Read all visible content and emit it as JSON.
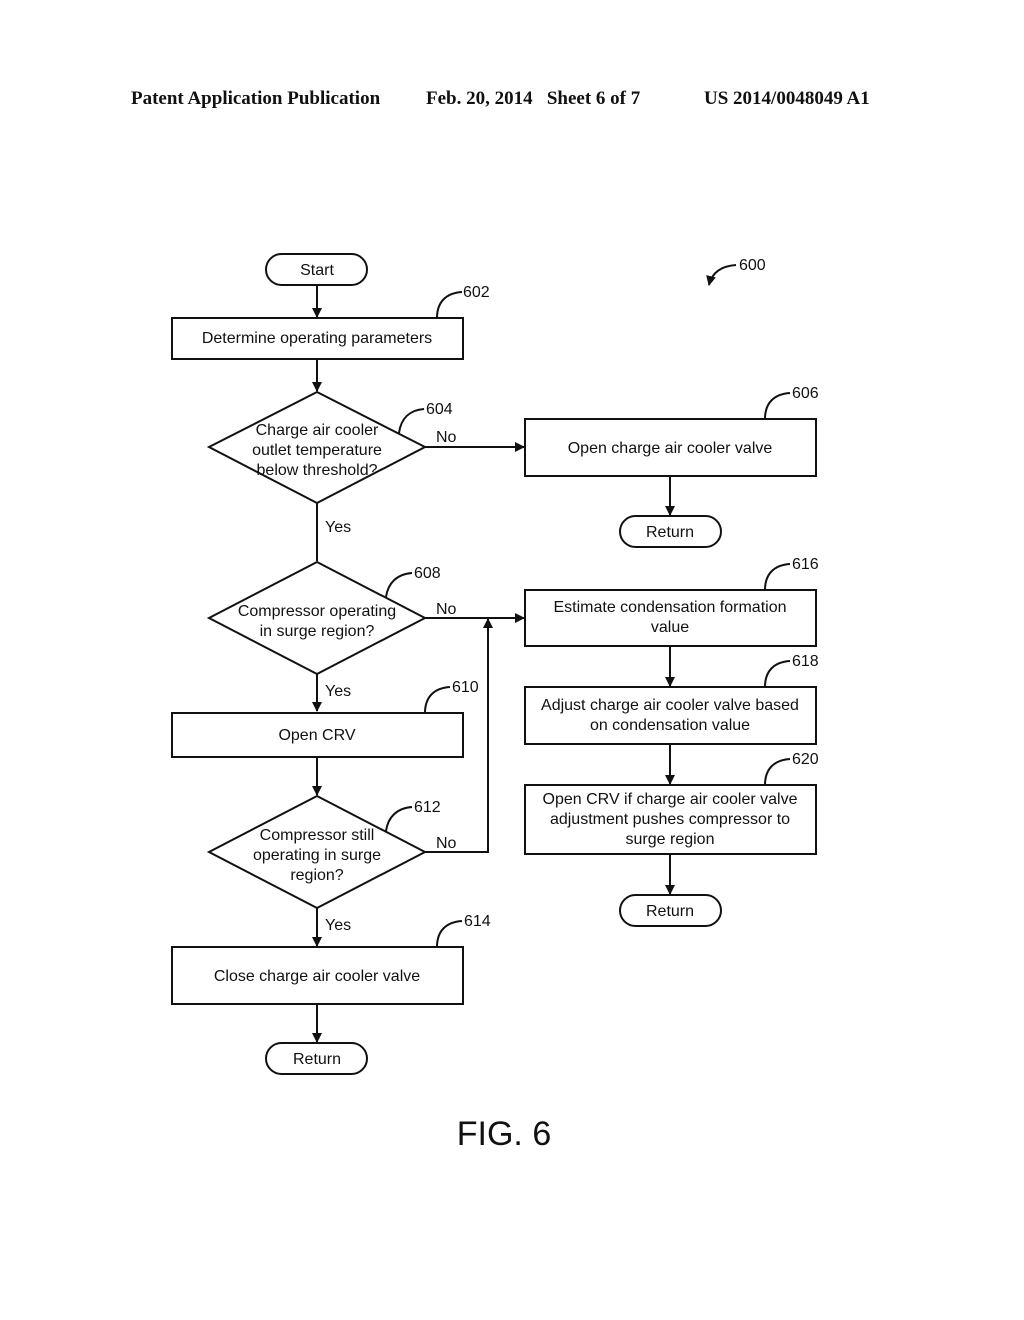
{
  "header": {
    "publication": "Patent Application Publication",
    "date_sheet": "Feb. 20, 2014   Sheet 6 of 7",
    "patent_number": "US 2014/0048049 A1"
  },
  "figure": {
    "label": "FIG. 6",
    "ref": "600"
  },
  "nodes": {
    "start": {
      "text": "Start"
    },
    "n602": {
      "ref": "602",
      "lines": [
        "Determine operating parameters"
      ]
    },
    "n604": {
      "ref": "604",
      "lines": [
        "Charge air cooler",
        "outlet temperature",
        "below threshold?"
      ]
    },
    "n606": {
      "ref": "606",
      "lines": [
        "Open charge air cooler valve"
      ]
    },
    "return1": {
      "text": "Return"
    },
    "n608": {
      "ref": "608",
      "lines": [
        "Compressor operating",
        "in surge region?"
      ]
    },
    "n610": {
      "ref": "610",
      "lines": [
        "Open CRV"
      ]
    },
    "n612": {
      "ref": "612",
      "lines": [
        "Compressor still",
        "operating in surge",
        "region?"
      ]
    },
    "n614": {
      "ref": "614",
      "lines": [
        "Close charge air cooler valve"
      ]
    },
    "return2": {
      "text": "Return"
    },
    "n616": {
      "ref": "616",
      "lines": [
        "Estimate condensation formation",
        "value"
      ]
    },
    "n618": {
      "ref": "618",
      "lines": [
        "Adjust charge air cooler valve based",
        "on condensation value"
      ]
    },
    "n620": {
      "ref": "620",
      "lines": [
        "Open CRV if charge air cooler valve",
        "adjustment pushes compressor to",
        "surge region"
      ]
    },
    "return3": {
      "text": "Return"
    }
  },
  "edge_labels": {
    "no_604": "No",
    "yes_604": "Yes",
    "no_608": "No",
    "yes_608": "Yes",
    "no_612": "No",
    "yes_612": "Yes"
  }
}
